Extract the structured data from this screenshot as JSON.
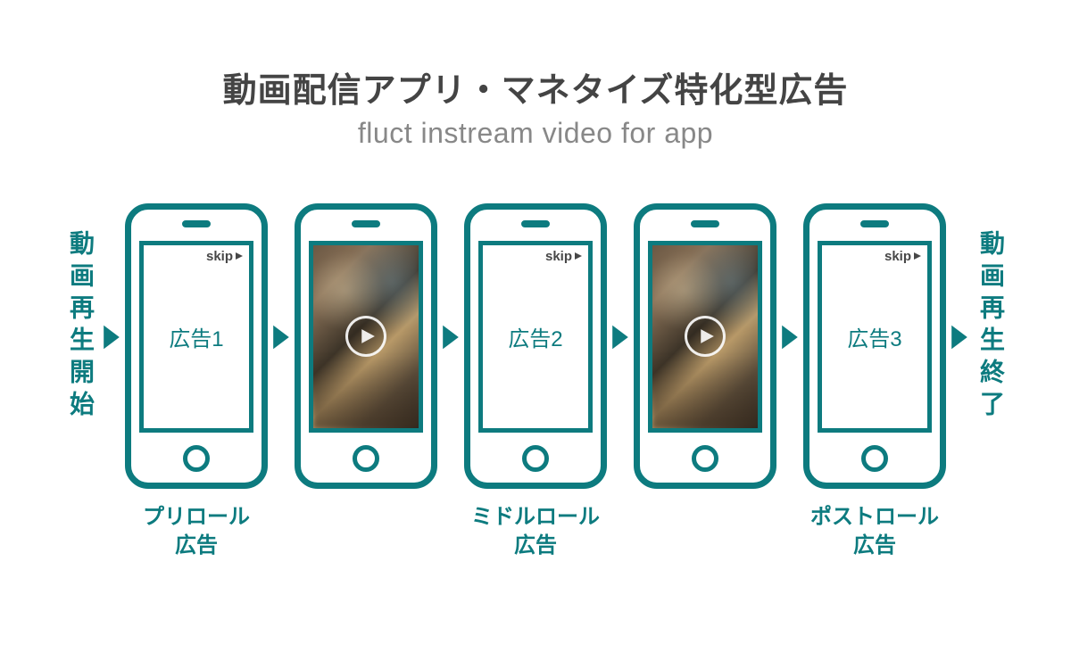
{
  "title": {
    "jp": "動画配信アプリ・マネタイズ特化型広告",
    "en": "fluct instream video for app"
  },
  "side_left": "動画再生開始",
  "side_right": "動画再生終了",
  "skip_label": "skip",
  "phones": [
    {
      "type": "ad",
      "ad_label": "広告1",
      "caption_l1": "プリロール",
      "caption_l2": "広告"
    },
    {
      "type": "content"
    },
    {
      "type": "ad",
      "ad_label": "広告2",
      "caption_l1": "ミドルロール",
      "caption_l2": "広告"
    },
    {
      "type": "content"
    },
    {
      "type": "ad",
      "ad_label": "広告3",
      "caption_l1": "ポストロール",
      "caption_l2": "広告"
    }
  ],
  "colors": {
    "teal": "#0d7b7f",
    "text_gray": "#444",
    "sub_gray": "#888"
  }
}
